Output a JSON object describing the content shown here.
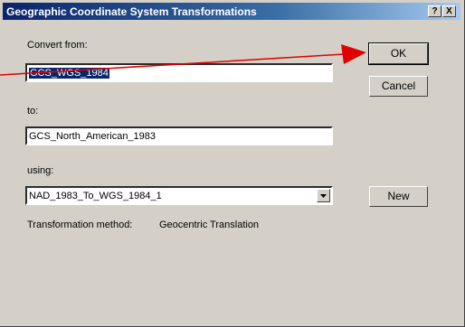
{
  "window": {
    "title": "Geographic Coordinate System Transformations",
    "help_button": "?",
    "close_button": "X"
  },
  "form": {
    "convert_from_label": "Convert from:",
    "convert_from_value": "GCS_WGS_1984",
    "to_label": "to:",
    "to_value": "GCS_North_American_1983",
    "using_label": "using:",
    "using_value": "NAD_1983_To_WGS_1984_1",
    "method_label": "Transformation method:",
    "method_value": "Geocentric Translation"
  },
  "buttons": {
    "ok": "OK",
    "cancel": "Cancel",
    "new": "New"
  },
  "colors": {
    "titlebar": "#0a246a",
    "annotation_arrow": "#e00000",
    "dialog_face": "#d4d0c8"
  }
}
